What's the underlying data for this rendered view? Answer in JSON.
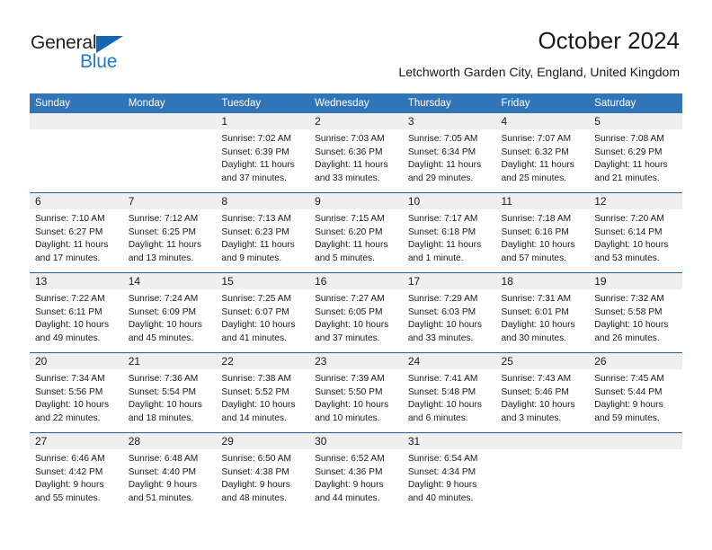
{
  "brand": {
    "name_top": "General",
    "name_bottom": "Blue",
    "triangle_color": "#1565b0",
    "blue_color": "#1d7dd4",
    "dark_color": "#231f20"
  },
  "header": {
    "title": "October 2024",
    "subtitle": "Letchworth Garden City, England, United Kingdom"
  },
  "theme": {
    "header_blue": "#3075b8",
    "row_rule_blue": "#1f5fa0",
    "date_band_gray": "#efefef",
    "text_color": "#1a1a1a"
  },
  "weekdays": [
    "Sunday",
    "Monday",
    "Tuesday",
    "Wednesday",
    "Thursday",
    "Friday",
    "Saturday"
  ],
  "weeks": [
    [
      {
        "day": "",
        "sunrise": "",
        "sunset": "",
        "daylight_line1": "",
        "daylight_line2": ""
      },
      {
        "day": "",
        "sunrise": "",
        "sunset": "",
        "daylight_line1": "",
        "daylight_line2": ""
      },
      {
        "day": "1",
        "sunrise": "Sunrise: 7:02 AM",
        "sunset": "Sunset: 6:39 PM",
        "daylight_line1": "Daylight: 11 hours",
        "daylight_line2": "and 37 minutes."
      },
      {
        "day": "2",
        "sunrise": "Sunrise: 7:03 AM",
        "sunset": "Sunset: 6:36 PM",
        "daylight_line1": "Daylight: 11 hours",
        "daylight_line2": "and 33 minutes."
      },
      {
        "day": "3",
        "sunrise": "Sunrise: 7:05 AM",
        "sunset": "Sunset: 6:34 PM",
        "daylight_line1": "Daylight: 11 hours",
        "daylight_line2": "and 29 minutes."
      },
      {
        "day": "4",
        "sunrise": "Sunrise: 7:07 AM",
        "sunset": "Sunset: 6:32 PM",
        "daylight_line1": "Daylight: 11 hours",
        "daylight_line2": "and 25 minutes."
      },
      {
        "day": "5",
        "sunrise": "Sunrise: 7:08 AM",
        "sunset": "Sunset: 6:29 PM",
        "daylight_line1": "Daylight: 11 hours",
        "daylight_line2": "and 21 minutes."
      }
    ],
    [
      {
        "day": "6",
        "sunrise": "Sunrise: 7:10 AM",
        "sunset": "Sunset: 6:27 PM",
        "daylight_line1": "Daylight: 11 hours",
        "daylight_line2": "and 17 minutes."
      },
      {
        "day": "7",
        "sunrise": "Sunrise: 7:12 AM",
        "sunset": "Sunset: 6:25 PM",
        "daylight_line1": "Daylight: 11 hours",
        "daylight_line2": "and 13 minutes."
      },
      {
        "day": "8",
        "sunrise": "Sunrise: 7:13 AM",
        "sunset": "Sunset: 6:23 PM",
        "daylight_line1": "Daylight: 11 hours",
        "daylight_line2": "and 9 minutes."
      },
      {
        "day": "9",
        "sunrise": "Sunrise: 7:15 AM",
        "sunset": "Sunset: 6:20 PM",
        "daylight_line1": "Daylight: 11 hours",
        "daylight_line2": "and 5 minutes."
      },
      {
        "day": "10",
        "sunrise": "Sunrise: 7:17 AM",
        "sunset": "Sunset: 6:18 PM",
        "daylight_line1": "Daylight: 11 hours",
        "daylight_line2": "and 1 minute."
      },
      {
        "day": "11",
        "sunrise": "Sunrise: 7:18 AM",
        "sunset": "Sunset: 6:16 PM",
        "daylight_line1": "Daylight: 10 hours",
        "daylight_line2": "and 57 minutes."
      },
      {
        "day": "12",
        "sunrise": "Sunrise: 7:20 AM",
        "sunset": "Sunset: 6:14 PM",
        "daylight_line1": "Daylight: 10 hours",
        "daylight_line2": "and 53 minutes."
      }
    ],
    [
      {
        "day": "13",
        "sunrise": "Sunrise: 7:22 AM",
        "sunset": "Sunset: 6:11 PM",
        "daylight_line1": "Daylight: 10 hours",
        "daylight_line2": "and 49 minutes."
      },
      {
        "day": "14",
        "sunrise": "Sunrise: 7:24 AM",
        "sunset": "Sunset: 6:09 PM",
        "daylight_line1": "Daylight: 10 hours",
        "daylight_line2": "and 45 minutes."
      },
      {
        "day": "15",
        "sunrise": "Sunrise: 7:25 AM",
        "sunset": "Sunset: 6:07 PM",
        "daylight_line1": "Daylight: 10 hours",
        "daylight_line2": "and 41 minutes."
      },
      {
        "day": "16",
        "sunrise": "Sunrise: 7:27 AM",
        "sunset": "Sunset: 6:05 PM",
        "daylight_line1": "Daylight: 10 hours",
        "daylight_line2": "and 37 minutes."
      },
      {
        "day": "17",
        "sunrise": "Sunrise: 7:29 AM",
        "sunset": "Sunset: 6:03 PM",
        "daylight_line1": "Daylight: 10 hours",
        "daylight_line2": "and 33 minutes."
      },
      {
        "day": "18",
        "sunrise": "Sunrise: 7:31 AM",
        "sunset": "Sunset: 6:01 PM",
        "daylight_line1": "Daylight: 10 hours",
        "daylight_line2": "and 30 minutes."
      },
      {
        "day": "19",
        "sunrise": "Sunrise: 7:32 AM",
        "sunset": "Sunset: 5:58 PM",
        "daylight_line1": "Daylight: 10 hours",
        "daylight_line2": "and 26 minutes."
      }
    ],
    [
      {
        "day": "20",
        "sunrise": "Sunrise: 7:34 AM",
        "sunset": "Sunset: 5:56 PM",
        "daylight_line1": "Daylight: 10 hours",
        "daylight_line2": "and 22 minutes."
      },
      {
        "day": "21",
        "sunrise": "Sunrise: 7:36 AM",
        "sunset": "Sunset: 5:54 PM",
        "daylight_line1": "Daylight: 10 hours",
        "daylight_line2": "and 18 minutes."
      },
      {
        "day": "22",
        "sunrise": "Sunrise: 7:38 AM",
        "sunset": "Sunset: 5:52 PM",
        "daylight_line1": "Daylight: 10 hours",
        "daylight_line2": "and 14 minutes."
      },
      {
        "day": "23",
        "sunrise": "Sunrise: 7:39 AM",
        "sunset": "Sunset: 5:50 PM",
        "daylight_line1": "Daylight: 10 hours",
        "daylight_line2": "and 10 minutes."
      },
      {
        "day": "24",
        "sunrise": "Sunrise: 7:41 AM",
        "sunset": "Sunset: 5:48 PM",
        "daylight_line1": "Daylight: 10 hours",
        "daylight_line2": "and 6 minutes."
      },
      {
        "day": "25",
        "sunrise": "Sunrise: 7:43 AM",
        "sunset": "Sunset: 5:46 PM",
        "daylight_line1": "Daylight: 10 hours",
        "daylight_line2": "and 3 minutes."
      },
      {
        "day": "26",
        "sunrise": "Sunrise: 7:45 AM",
        "sunset": "Sunset: 5:44 PM",
        "daylight_line1": "Daylight: 9 hours",
        "daylight_line2": "and 59 minutes."
      }
    ],
    [
      {
        "day": "27",
        "sunrise": "Sunrise: 6:46 AM",
        "sunset": "Sunset: 4:42 PM",
        "daylight_line1": "Daylight: 9 hours",
        "daylight_line2": "and 55 minutes."
      },
      {
        "day": "28",
        "sunrise": "Sunrise: 6:48 AM",
        "sunset": "Sunset: 4:40 PM",
        "daylight_line1": "Daylight: 9 hours",
        "daylight_line2": "and 51 minutes."
      },
      {
        "day": "29",
        "sunrise": "Sunrise: 6:50 AM",
        "sunset": "Sunset: 4:38 PM",
        "daylight_line1": "Daylight: 9 hours",
        "daylight_line2": "and 48 minutes."
      },
      {
        "day": "30",
        "sunrise": "Sunrise: 6:52 AM",
        "sunset": "Sunset: 4:36 PM",
        "daylight_line1": "Daylight: 9 hours",
        "daylight_line2": "and 44 minutes."
      },
      {
        "day": "31",
        "sunrise": "Sunrise: 6:54 AM",
        "sunset": "Sunset: 4:34 PM",
        "daylight_line1": "Daylight: 9 hours",
        "daylight_line2": "and 40 minutes."
      },
      {
        "day": "",
        "sunrise": "",
        "sunset": "",
        "daylight_line1": "",
        "daylight_line2": ""
      },
      {
        "day": "",
        "sunrise": "",
        "sunset": "",
        "daylight_line1": "",
        "daylight_line2": ""
      }
    ]
  ]
}
